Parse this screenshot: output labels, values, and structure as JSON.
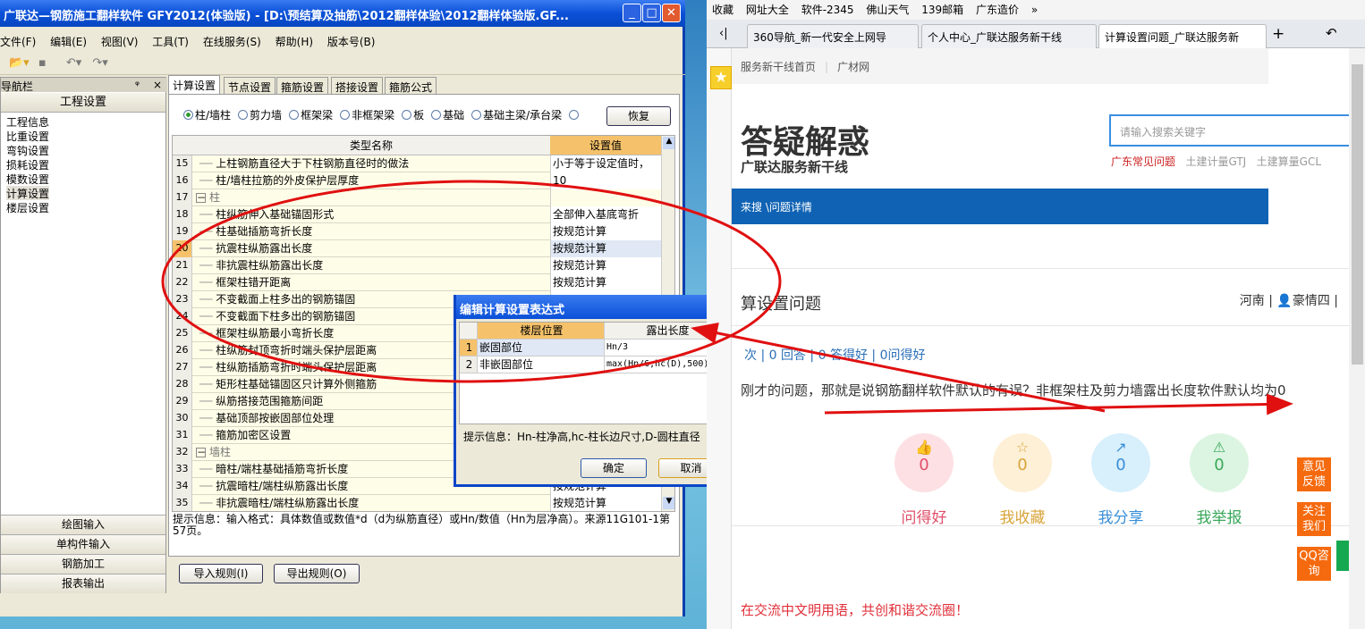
{
  "app": {
    "title": "广联达—钢筋施工翻样软件 GFY2012(体验版) - [D:\\预结算及抽筋\\2012翻样体验\\2012翻样体验版.GF...",
    "menu": [
      "文件(F)",
      "编辑(E)",
      "视图(V)",
      "工具(T)",
      "在线服务(S)",
      "帮助(H)",
      "版本号(B)"
    ],
    "nav": {
      "title": "导航栏",
      "group": "工程设置",
      "items": [
        "工程信息",
        "比重设置",
        "弯钩设置",
        "损耗设置",
        "模数设置",
        "计算设置",
        "楼层设置"
      ],
      "selected": "计算设置",
      "bottom": [
        "绘图输入",
        "单构件输入",
        "钢筋加工",
        "报表输出"
      ]
    },
    "tabs": [
      "计算设置",
      "节点设置",
      "箍筋设置",
      "搭接设置",
      "箍筋公式"
    ],
    "radios": [
      "柱/墙柱",
      "剪力墙",
      "框架梁",
      "非框架梁",
      "板",
      "基础",
      "基础主梁/承台梁"
    ],
    "radio_selected": "柱/墙柱",
    "restore": "恢复",
    "grid": {
      "headers": [
        "类型名称",
        "设置值"
      ],
      "rows": [
        {
          "num": "15",
          "name": "上柱钢筋直径大于下柱钢筋直径时的做法",
          "value": "小于等于设定值时，",
          "group": false
        },
        {
          "num": "16",
          "name": "柱/墙柱拉筋的外皮保护层厚度",
          "value": "10",
          "group": false
        },
        {
          "num": "17",
          "name": "柱",
          "value": "",
          "group": true
        },
        {
          "num": "18",
          "name": "柱纵筋伸入基础锚固形式",
          "value": "全部伸入基底弯折",
          "group": false
        },
        {
          "num": "19",
          "name": "柱基础插筋弯折长度",
          "value": "按规范计算",
          "group": false
        },
        {
          "num": "20",
          "name": "抗震柱纵筋露出长度",
          "value": "按规范计算",
          "group": false
        },
        {
          "num": "21",
          "name": "非抗震柱纵筋露出长度",
          "value": "按规范计算",
          "group": false
        },
        {
          "num": "22",
          "name": "框架柱错开距离",
          "value": "按规范计算",
          "group": false
        },
        {
          "num": "23",
          "name": "不变截面上柱多出的钢筋锚固",
          "value": "",
          "group": false
        },
        {
          "num": "24",
          "name": "不变截面下柱多出的钢筋锚固",
          "value": "",
          "group": false
        },
        {
          "num": "25",
          "name": "框架柱纵筋最小弯折长度",
          "value": "",
          "group": false
        },
        {
          "num": "26",
          "name": "柱纵筋封顶弯折时端头保护层距离",
          "value": "",
          "group": false
        },
        {
          "num": "27",
          "name": "柱纵筋插筋弯折时端头保护层距离",
          "value": "",
          "group": false
        },
        {
          "num": "28",
          "name": "矩形柱基础锚固区只计算外侧箍筋",
          "value": "",
          "group": false
        },
        {
          "num": "29",
          "name": "纵筋搭接范围箍筋间距",
          "value": "",
          "group": false
        },
        {
          "num": "30",
          "name": "基础顶部按嵌固部位处理",
          "value": "",
          "group": false
        },
        {
          "num": "31",
          "name": "箍筋加密区设置",
          "value": "",
          "group": false
        },
        {
          "num": "32",
          "name": "墙柱",
          "value": "",
          "group": true
        },
        {
          "num": "33",
          "name": "暗柱/端柱基础插筋弯折长度",
          "value": "",
          "group": false
        },
        {
          "num": "34",
          "name": "抗震暗柱/端柱纵筋露出长度",
          "value": "按规范计算",
          "group": false
        },
        {
          "num": "35",
          "name": "非抗震暗柱/端柱纵筋露出长度",
          "value": "按规范计算",
          "group": false
        }
      ],
      "selected_row": "20"
    },
    "hint": "提示信息：输入格式：具体数值或数值*d（d为纵筋直径）或Hn/数值（Hn为层净高）。来源11G101-1第57页。",
    "import": "导入规则(I)",
    "export": "导出规则(O)"
  },
  "dialog": {
    "title": "编辑计算设置表达式",
    "headers": [
      "楼层位置",
      "露出长度"
    ],
    "rows": [
      {
        "num": "1",
        "pos": "嵌固部位",
        "len": "Hn/3"
      },
      {
        "num": "2",
        "pos": "非嵌固部位",
        "len": "max(Hn/6,hc(D),500)"
      }
    ],
    "hint": "提示信息：Hn-柱净高,hc-柱长边尺寸,D-圆柱直径",
    "ok": "确定",
    "cancel": "取消"
  },
  "browser": {
    "favorites": [
      "收藏",
      "网址大全",
      "软件-2345",
      "佛山天气",
      "139邮箱",
      "广东造价"
    ],
    "tabs": [
      "360导航_新一代安全上网导",
      "个人中心_广联达服务新干线",
      "计算设置问题_广联达服务新"
    ],
    "toplinks": [
      "服务新干线首页",
      "广材网"
    ],
    "logo": "答疑解惑",
    "logo_sub": "广联达服务新干线",
    "search_placeholder": "请输入搜索关键字",
    "hot": [
      "广东常见问题",
      "土建计量GTJ",
      "土建算量GCL"
    ],
    "breadcrumb": "来搜 \\问题详情",
    "question_title": "算设置问题",
    "meta_region": "河南",
    "meta_user": "豪情四",
    "stats": "次 | 0 回答 | 0 答得好 | 0问得好",
    "body": "刚才的问题，那就是说钢筋翻样软件默认的有误？非框架柱及剪力墙露出长度软件默认均为0",
    "actions": [
      {
        "label": "问得好",
        "count": "0",
        "icon": "thumbs-up",
        "color": "#e0506a",
        "bg": "#fde0e4"
      },
      {
        "label": "我收藏",
        "count": "0",
        "icon": "star",
        "color": "#d9a43a",
        "bg": "#fdf0d6"
      },
      {
        "label": "我分享",
        "count": "0",
        "icon": "share",
        "color": "#3a8fd8",
        "bg": "#d8effc"
      },
      {
        "label": "我举报",
        "count": "0",
        "icon": "warning",
        "color": "#3aa85a",
        "bg": "#dcf5e2"
      }
    ],
    "side": [
      "意见反馈",
      "关注我们",
      "QQ咨询"
    ],
    "footer": "在交流中文明用语，共创和谐交流圈！"
  },
  "colors": {
    "annotation": "#e01010",
    "titlebar": "#0a50d8",
    "header_orange": "#f5c26b"
  }
}
